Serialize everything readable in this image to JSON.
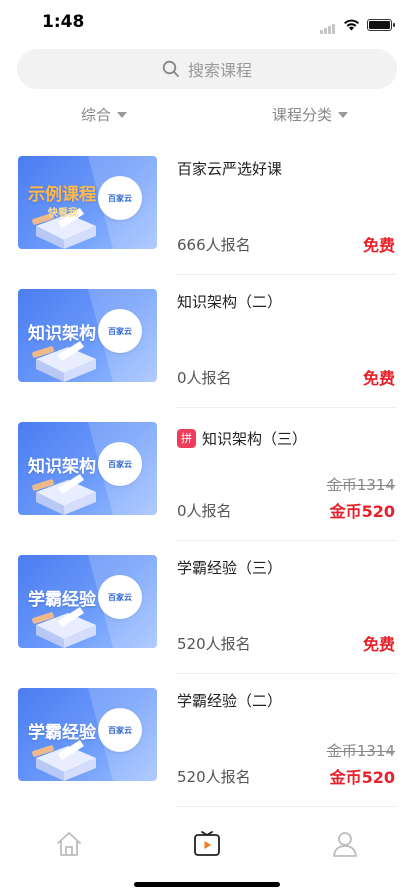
{
  "status_bar": {
    "time": "1:48"
  },
  "search": {
    "placeholder": "搜索课程",
    "icon": "search-icon"
  },
  "filters": [
    {
      "label": "综合"
    },
    {
      "label": "课程分类"
    }
  ],
  "colors": {
    "price_red": "#e8202a",
    "badge_red": "#ee3d5c",
    "thumb_blue": "#4c7cf0"
  },
  "courses": [
    {
      "title": "百家云严选好课",
      "thumb_text": "示例课程",
      "thumb_sub": "快看我",
      "logo_text": "百家云",
      "enrolled": "666人报名",
      "price": "免费"
    },
    {
      "title": "知识架构（二）",
      "thumb_text": "知识架构",
      "logo_text": "百家云",
      "enrolled": "0人报名",
      "price": "免费"
    },
    {
      "badge": "拼",
      "title": "知识架构（三）",
      "thumb_text": "知识架构",
      "logo_text": "百家云",
      "enrolled": "0人报名",
      "original_price": "金币1314",
      "price": "金币520"
    },
    {
      "title": "学霸经验（三）",
      "thumb_text": "学霸经验",
      "logo_text": "百家云",
      "enrolled": "520人报名",
      "price": "免费"
    },
    {
      "title": "学霸经验（二）",
      "thumb_text": "学霸经验",
      "logo_text": "百家云",
      "enrolled": "520人报名",
      "original_price": "金币1314",
      "price": "金币520"
    }
  ],
  "tab_bar": {
    "items": [
      {
        "icon": "home-icon",
        "active": false
      },
      {
        "icon": "course-video-icon",
        "active": true
      },
      {
        "icon": "profile-icon",
        "active": false
      }
    ]
  }
}
